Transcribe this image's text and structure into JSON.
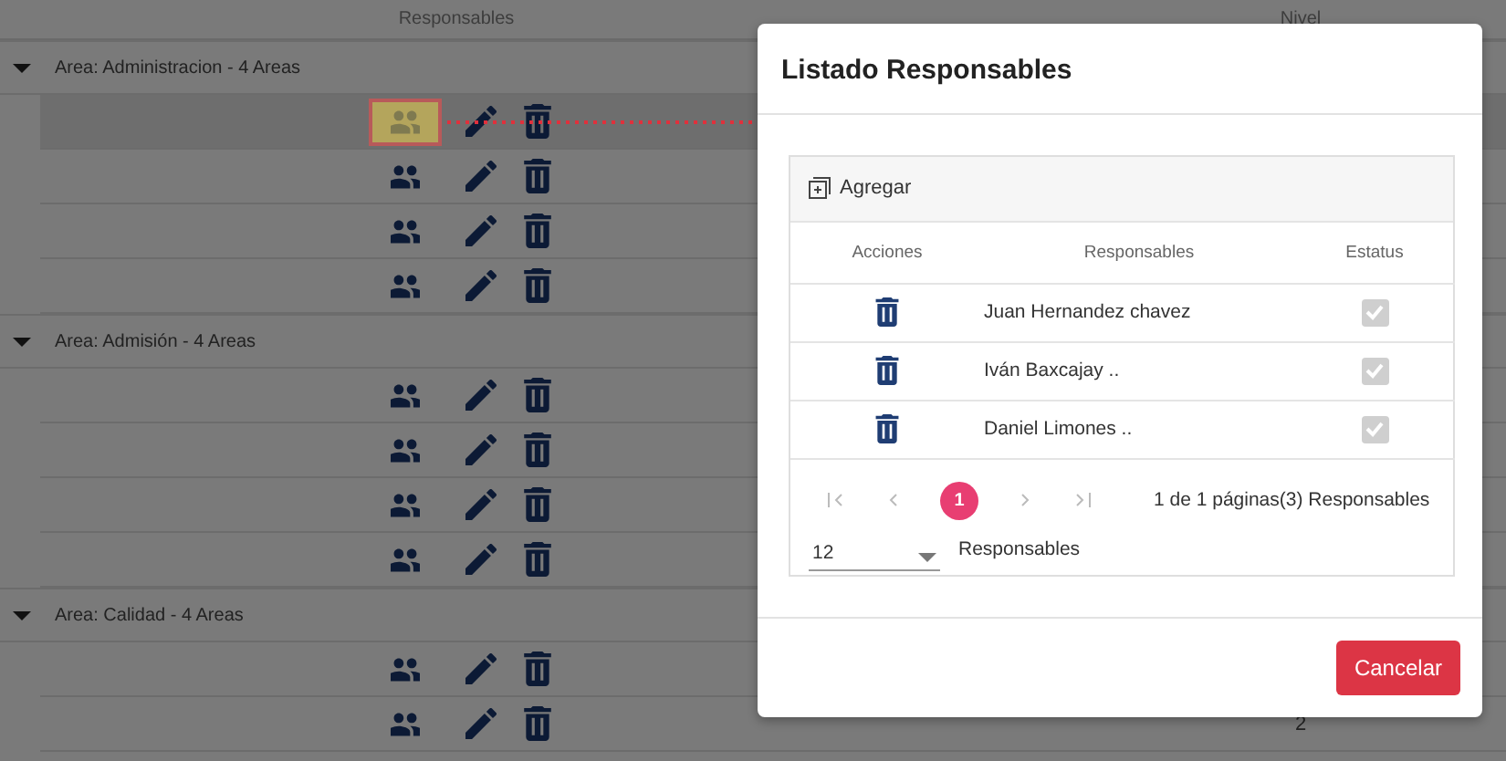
{
  "background_table": {
    "columns": [
      "Responsables",
      "Nivel"
    ],
    "groups": [
      {
        "label": "Area: Administracion - 4 Areas",
        "expanded": true,
        "rows": [
          {
            "selected": true
          },
          {
            "selected": false
          },
          {
            "selected": false
          },
          {
            "selected": false
          }
        ]
      },
      {
        "label": "Area: Admisión - 4 Areas",
        "expanded": true,
        "rows": [
          {
            "selected": false
          },
          {
            "selected": false
          },
          {
            "selected": false
          },
          {
            "selected": false
          }
        ]
      },
      {
        "label": "Area: Calidad - 4 Areas",
        "expanded": true,
        "rows": [
          {
            "selected": false
          },
          {
            "selected": false,
            "nivel": "2"
          }
        ]
      }
    ]
  },
  "dialog": {
    "title": "Listado Responsables",
    "add_button": "Agregar",
    "columns": [
      "Acciones",
      "Responsables",
      "Estatus"
    ],
    "rows": [
      {
        "name": "Juan Hernandez chavez",
        "checked": true
      },
      {
        "name": "Iván Baxcajay ..",
        "checked": true
      },
      {
        "name": "Daniel Limones ..",
        "checked": true
      }
    ],
    "pagination": {
      "pages": [
        {
          "label": "1",
          "selected": true
        }
      ],
      "summary": "1 de 1 páginas(3) Responsables",
      "page_size": "12",
      "page_size_label": "Responsables"
    },
    "buttons": [
      "Cancelar"
    ]
  }
}
